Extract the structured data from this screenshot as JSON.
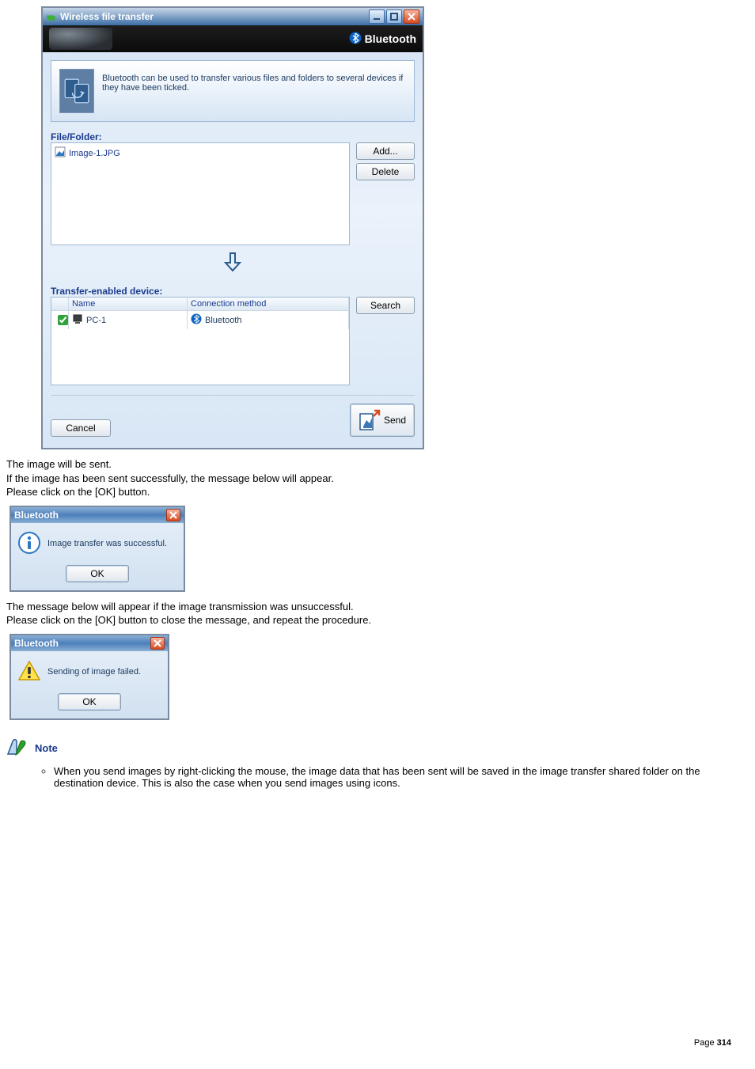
{
  "transfer_dialog": {
    "title": "Wireless file transfer",
    "brand": "Bluetooth",
    "description": "Bluetooth can be used to transfer various files and folders to several devices if they have been ticked.",
    "file_folder_label": "File/Folder:",
    "files": [
      "Image-1.JPG"
    ],
    "add_button": "Add...",
    "delete_button": "Delete",
    "transfer_label": "Transfer-enabled device:",
    "device_columns": {
      "name": "Name",
      "connection": "Connection method"
    },
    "devices": [
      {
        "checked": true,
        "name": "PC-1",
        "connection": "Bluetooth"
      }
    ],
    "search_button": "Search",
    "cancel_button": "Cancel",
    "send_button": "Send"
  },
  "body_after_dialog": {
    "line1": "The image will be sent.",
    "line2": "If the image has been sent successfully, the message below will appear.",
    "line3": "Please click on the [OK] button."
  },
  "msg_success": {
    "title": "Bluetooth",
    "text": "Image transfer was successful.",
    "ok": "OK"
  },
  "body_after_success": {
    "line1": "The message below will appear if the image transmission was unsuccessful.",
    "line2": "Please click on the [OK] button to close the message, and repeat the procedure."
  },
  "msg_fail": {
    "title": "Bluetooth",
    "text": "Sending of image failed.",
    "ok": "OK"
  },
  "note": {
    "heading": "Note",
    "items": [
      "When you send images by right-clicking the mouse, the image data that has been sent will be saved in the image transfer shared folder on the destination device. This is also the case when you send images using icons."
    ]
  },
  "page_label": "Page",
  "page_number": "314"
}
